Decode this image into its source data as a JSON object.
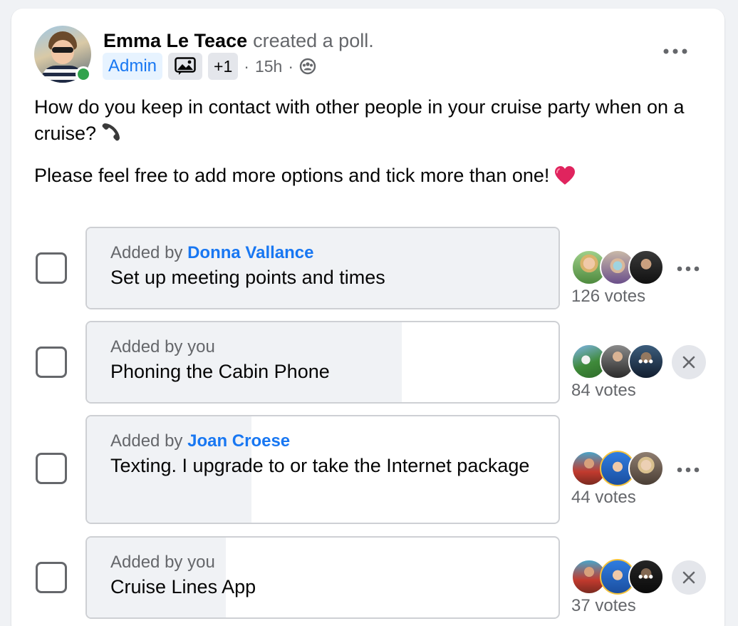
{
  "post": {
    "author": "Emma Le Teace",
    "action": "created a poll.",
    "badge": "Admin",
    "badge_extra": "+1",
    "time": "15h",
    "separator": "·",
    "body_line1": "How do you keep in contact with other people in your cruise party when on a cruise?",
    "body_line2": "Please feel free to add more options and tick more than one!",
    "audience_icon": "group-members-icon",
    "colors": {
      "accent": "#1877f2",
      "online": "#31a24c",
      "heart": "#e0245e"
    }
  },
  "poll": {
    "options": [
      {
        "added_by_prefix": "Added by",
        "added_by": "Donna Vallance",
        "text": "Set up meeting points and times",
        "votes_label": "126 votes",
        "votes": 126,
        "fill_fraction": 1.0,
        "action": "more"
      },
      {
        "added_by_prefix": "Added by",
        "added_by": "you",
        "text": "Phoning the Cabin Phone",
        "votes_label": "84 votes",
        "votes": 84,
        "fill_fraction": 0.667,
        "action": "remove"
      },
      {
        "added_by_prefix": "Added by",
        "added_by": "Joan Croese",
        "text": "Texting. I upgrade to or take the Internet package",
        "votes_label": "44 votes",
        "votes": 44,
        "fill_fraction": 0.349,
        "action": "more"
      },
      {
        "added_by_prefix": "Added by",
        "added_by": "you",
        "text": "Cruise Lines App",
        "votes_label": "37 votes",
        "votes": 37,
        "fill_fraction": 0.294,
        "action": "remove"
      }
    ],
    "more_overlay": "•••"
  }
}
